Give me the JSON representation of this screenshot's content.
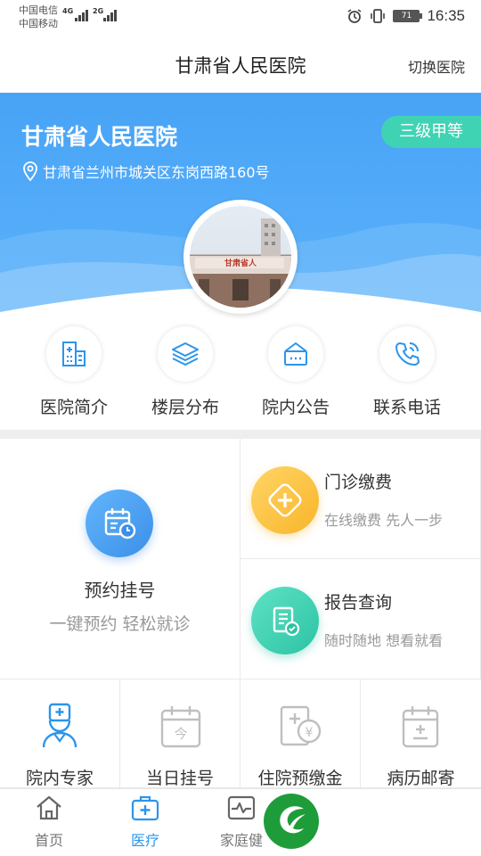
{
  "status_bar": {
    "carrier1": "中国电信",
    "carrier2": "中国移动",
    "net1": "4G",
    "net2": "2G",
    "battery": "71",
    "time": "16:35"
  },
  "nav": {
    "title": "甘肃省人民医院",
    "switch": "切换医院"
  },
  "hospital": {
    "name": "甘肃省人民医院",
    "grade": "三级甲等",
    "address": "甘肃省兰州市城关区东岗西路160号",
    "sign_text": "甘肃省人"
  },
  "quick_links": [
    {
      "label": "医院简介",
      "icon": "building-icon"
    },
    {
      "label": "楼层分布",
      "icon": "layers-icon"
    },
    {
      "label": "院内公告",
      "icon": "notice-board-icon"
    },
    {
      "label": "联系电话",
      "icon": "phone-icon"
    }
  ],
  "services": {
    "appointment": {
      "title": "预约挂号",
      "sub": "一键预约 轻松就诊"
    },
    "payment": {
      "title": "门诊缴费",
      "sub": "在线缴费 先人一步"
    },
    "report": {
      "title": "报告查询",
      "sub": "随时随地 想看就看"
    },
    "small": [
      {
        "label": "院内专家",
        "icon": "doctor-icon"
      },
      {
        "label": "当日挂号",
        "icon": "calendar-today-icon"
      },
      {
        "label": "住院预缴金",
        "icon": "deposit-icon"
      },
      {
        "label": "病历邮寄",
        "icon": "medical-record-icon"
      }
    ]
  },
  "tabs": [
    {
      "label": "首页",
      "icon": "home-icon"
    },
    {
      "label": "医疗",
      "icon": "medical-kit-icon"
    },
    {
      "label": "家庭健",
      "icon": "health-monitor-icon"
    }
  ],
  "colors": {
    "primary": "#48a3f6",
    "grade_badge": "#3fd3b4",
    "active_tab": "#2b95ec",
    "fab": "#1f9c3a"
  }
}
